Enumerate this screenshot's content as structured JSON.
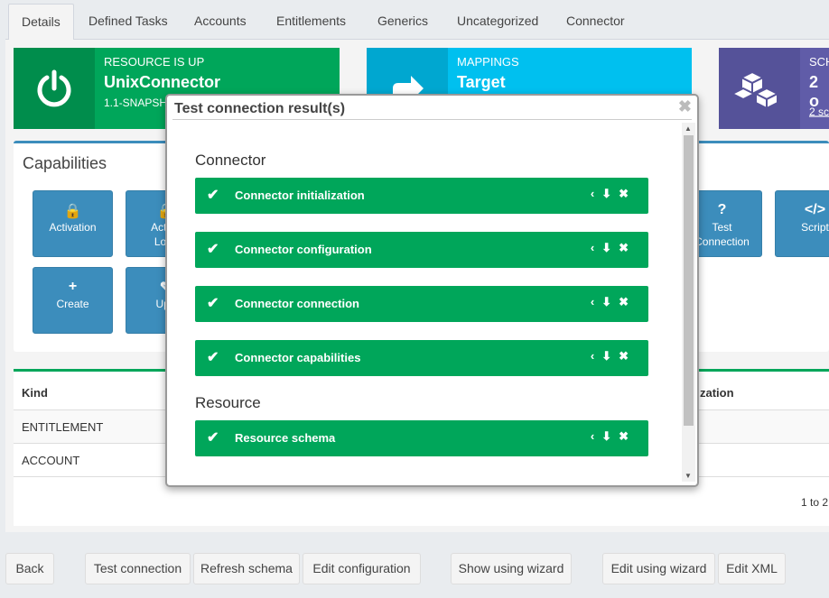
{
  "tabs": [
    "Details",
    "Defined Tasks",
    "Accounts",
    "Entitlements",
    "Generics",
    "Uncategorized",
    "Connector"
  ],
  "resource_box": {
    "caption": "RESOURCE IS UP",
    "value": "UnixConnector",
    "sub": "1.1-SNAPSH",
    "color": "#00a65a",
    "icon": "power-icon"
  },
  "mappings_box": {
    "caption": "MAPPINGS",
    "value": "Target",
    "color": "#00c0ef",
    "icon": "arrow-icon"
  },
  "schema_box": {
    "caption": "SCH",
    "value": "2 o",
    "sub": "2 sc",
    "color": "#605ca8",
    "icon": "cubes-icon"
  },
  "capabilities": {
    "title": "Capabilities",
    "row1": [
      {
        "label": "Activation",
        "icon": "lock-icon",
        "glyph": "🔒"
      },
      {
        "label": "Activa",
        "label2": "Lock",
        "icon": "lock-icon",
        "glyph": "🔒"
      },
      {
        "label": "Test",
        "label2": "Connection",
        "icon": "question-icon",
        "glyph": "?"
      },
      {
        "label": "Script",
        "icon": "code-icon",
        "glyph": "</>"
      }
    ],
    "row2": [
      {
        "label": "Create",
        "icon": "plus-icon",
        "glyph": "+"
      },
      {
        "label": "Upd",
        "icon": "edit-icon",
        "glyph": "✎"
      }
    ]
  },
  "table": {
    "headers": [
      "Kind",
      "zation"
    ],
    "rows": [
      "ENTITLEMENT",
      "ACCOUNT"
    ],
    "pagination": "1 to 2"
  },
  "footer_buttons": [
    "Back",
    "Test connection",
    "Refresh schema",
    "Edit configuration",
    "Show using wizard",
    "Edit using wizard",
    "Edit XML"
  ],
  "modal": {
    "title": "Test connection result(s)",
    "close": "✖",
    "sections": [
      {
        "name": "Connector",
        "results": [
          "Connector initialization",
          "Connector configuration",
          "Connector connection",
          "Connector capabilities"
        ]
      },
      {
        "name": "Resource",
        "results": [
          "Resource schema"
        ]
      }
    ],
    "actions": [
      "‹",
      "⬇",
      "✖"
    ],
    "check": "✔"
  }
}
